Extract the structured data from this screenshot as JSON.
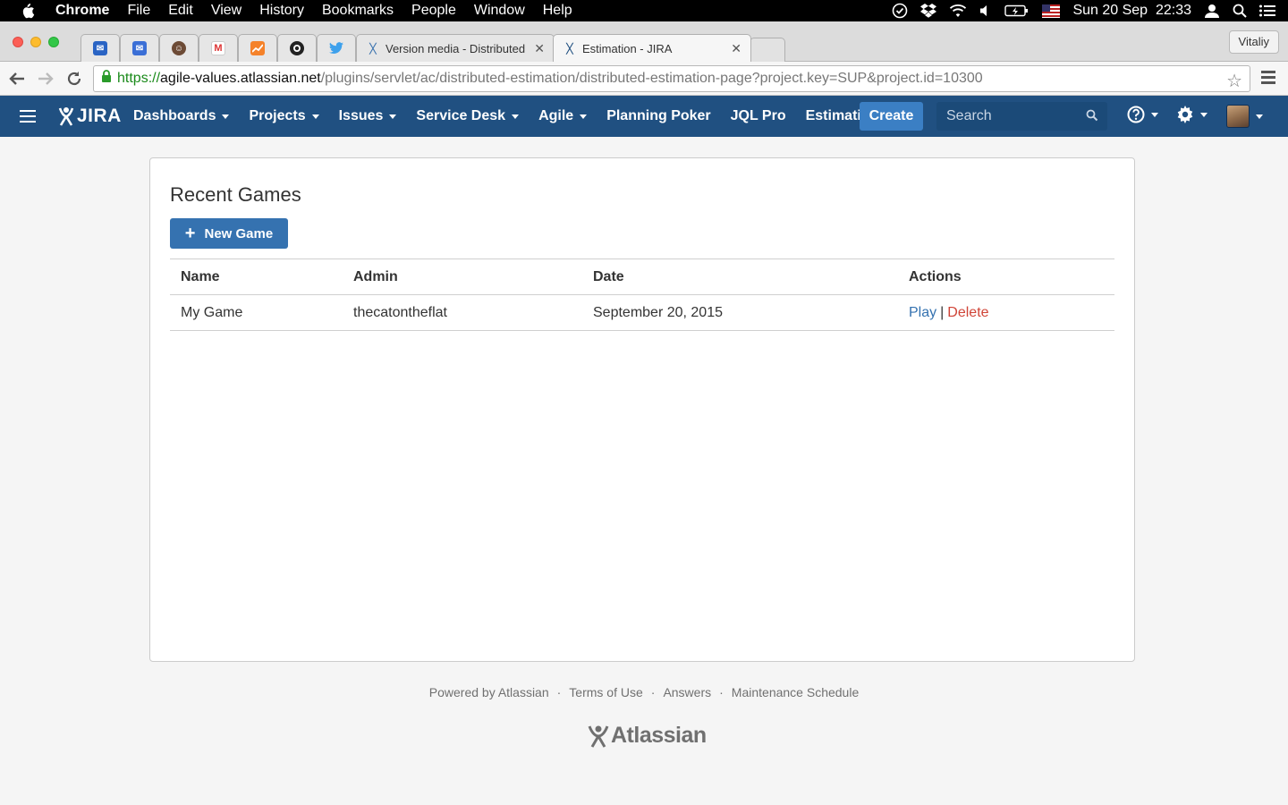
{
  "menubar": {
    "app": "Chrome",
    "items": [
      "File",
      "Edit",
      "View",
      "History",
      "Bookmarks",
      "People",
      "Window",
      "Help"
    ],
    "clock": "Sun 20 Sep  22:33"
  },
  "browser": {
    "tabs": [
      {
        "title": "Version media - Distributed E"
      },
      {
        "title": "Estimation - JIRA"
      }
    ],
    "profile": "Vitaliy",
    "url": {
      "scheme": "https://",
      "host": "agile-values.atlassian.net",
      "path": "/plugins/servlet/ac/distributed-estimation/distributed-estimation-page?project.key=SUP&project.id=10300"
    }
  },
  "jira": {
    "logo": "JIRA",
    "nav": [
      "Dashboards",
      "Projects",
      "Issues",
      "Service Desk",
      "Agile",
      "Planning Poker",
      "JQL Pro",
      "Estimation"
    ],
    "create": "Create",
    "search_placeholder": "Search"
  },
  "main": {
    "title": "Recent Games",
    "new_game": "New Game",
    "columns": [
      "Name",
      "Admin",
      "Date",
      "Actions"
    ],
    "rows": [
      {
        "name": "My Game",
        "admin": "thecatontheflat",
        "date": "September 20, 2015",
        "play": "Play",
        "sep": "|",
        "delete": "Delete"
      }
    ]
  },
  "footer": {
    "links": [
      "Powered by Atlassian",
      "Terms of Use",
      "Answers",
      "Maintenance Schedule"
    ],
    "dot": "·",
    "logo": "Atlassian"
  },
  "colors": {
    "jira_header": "#205081",
    "create_button": "#3b7fc4",
    "primary_button": "#3572b0",
    "delete_link": "#d04437"
  }
}
